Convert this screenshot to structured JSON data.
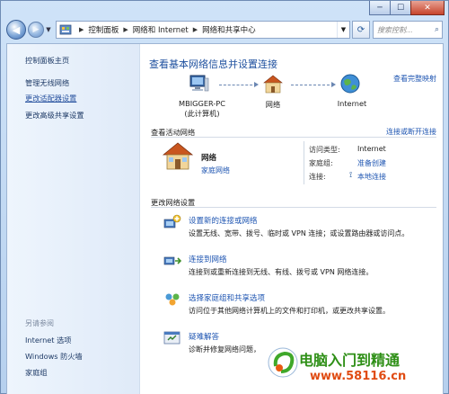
{
  "window": {
    "minimize": "─",
    "maximize": "☐",
    "close": "✕"
  },
  "address": {
    "crumbs": [
      "控制面板",
      "网络和 Internet",
      "网络和共享中心"
    ],
    "search_placeholder": "搜索控制..."
  },
  "sidebar": {
    "items": [
      "控制面板主页",
      "管理无线网络",
      "更改适配器设置",
      "更改高级共享设置"
    ],
    "see_also": "另请参阅",
    "see_also_items": [
      "Internet 选项",
      "Windows 防火墙",
      "家庭组"
    ]
  },
  "main": {
    "title": "查看基本网络信息并设置连接",
    "full_map": "查看完整映射",
    "nodes": [
      {
        "label": "MBIGGER-PC",
        "sub": "(此计算机)"
      },
      {
        "label": "网络",
        "sub": ""
      },
      {
        "label": "Internet",
        "sub": ""
      }
    ],
    "active_section": "查看活动网络",
    "connect_disconnect": "连接或断开连接",
    "network": {
      "name": "网络",
      "type": "家庭网络",
      "access_type_label": "访问类型:",
      "access_type_value": "Internet",
      "homegroup_label": "家庭组:",
      "homegroup_value": "准备创建",
      "connection_label": "连接:",
      "connection_value": "本地连接"
    },
    "change_section": "更改网络设置",
    "tasks": [
      {
        "title": "设置新的连接或网络",
        "desc": "设置无线、宽带、拨号、临时或 VPN 连接；或设置路由器或访问点。"
      },
      {
        "title": "连接到网络",
        "desc": "连接到或重新连接到无线、有线、拨号或 VPN 网络连接。"
      },
      {
        "title": "选择家庭组和共享选项",
        "desc": "访问位于其他网络计算机上的文件和打印机，或更改共享设置。"
      },
      {
        "title": "疑难解答",
        "desc": "诊断并修复网络问题，"
      }
    ]
  },
  "watermark": {
    "text": "电脑入门到精通",
    "url": "www.58116.cn"
  }
}
